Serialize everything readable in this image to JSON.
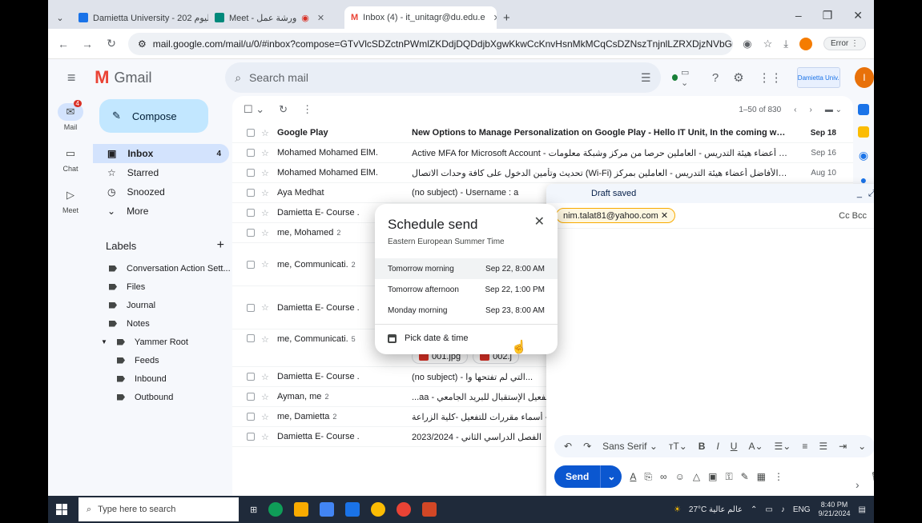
{
  "tabs": [
    {
      "title": "Damietta University - اليوم 202..",
      "active": false
    },
    {
      "title": "Meet - ورشة عمل",
      "active": false
    },
    {
      "title": "Inbox (4) - it_unitagr@du.edu.e",
      "active": true
    }
  ],
  "address_bar": {
    "url": "mail.google.com/mail/u/0/#inbox?compose=GTvVlcSDZctnPWmlZKDdjDQDdjbXgwKkwCcKnvHsnMkMCqCsDZNszTnjnlLZRXDjzNVbGmZLNRvSD",
    "error_label": "Error"
  },
  "gmail": {
    "brand": "Gmail",
    "search_placeholder": "Search mail",
    "org_logo_text": "Damietta Univ."
  },
  "rail": [
    {
      "label": "Mail",
      "badge": "4",
      "icon": "mail-icon"
    },
    {
      "label": "Chat",
      "icon": "chat-icon"
    },
    {
      "label": "Meet",
      "icon": "video-icon"
    }
  ],
  "sidebar": {
    "compose": "Compose",
    "items": [
      {
        "label": "Inbox",
        "count": "4",
        "icon": "inbox-icon"
      },
      {
        "label": "Starred",
        "count": "",
        "icon": "star-icon"
      },
      {
        "label": "Snoozed",
        "count": "",
        "icon": "clock-icon"
      },
      {
        "label": "More",
        "count": "",
        "icon": "chevron-down-icon"
      }
    ],
    "labels_heading": "Labels",
    "labels": [
      "Conversation Action Sett...",
      "Files",
      "Journal",
      "Notes",
      "Yammer Root"
    ],
    "sub_labels": [
      "Feeds",
      "Inbound",
      "Outbound"
    ]
  },
  "list": {
    "range": "1–50 of 830",
    "rows": [
      {
        "sender": "Google Play",
        "num": "",
        "subject": "New Options to Manage Personalization on Google Play - Hello IT Unit, In the coming weeks, Goog...",
        "date": "Sep 18",
        "unread": true
      },
      {
        "sender": "Mohamed Mohamed ElM.",
        "num": "",
        "subject": "Active MFA for Microsoft Account - السلام عليكم السادة الأفاضل أعضاء هيئة التدريس - العاملين حرصا من مركز وشبكة معلومات ...",
        "date": "Sep 16",
        "unread": false
      },
      {
        "sender": "Mohamed Mohamed ElM.",
        "num": "",
        "subject": "تحديث وتأمين الدخول على كافة وحدات الاتصال (Wi-Fi) بالجامعة - السلام عليكم السادة الأفاضل أعضاء هيئة التدريس - العاملين بمركز ...",
        "date": "Aug 10",
        "unread": false
      },
      {
        "sender": "Aya Medhat",
        "num": "",
        "subject": "(no subject) - Username : a",
        "date": "",
        "unread": false
      },
      {
        "sender": "Damietta E- Course .",
        "num": "",
        "subject": "",
        "date": "",
        "unread": false
      },
      {
        "sender": "me, Mohamed",
        "num": "2",
        "subject": "",
        "date": "",
        "unread": false
      },
      {
        "sender": "me, Communicati.",
        "num": "2",
        "subject": "",
        "date": "",
        "unread": false
      },
      {
        "sender": "Damietta E- Course .",
        "num": "",
        "subject": "",
        "date": "",
        "unread": false
      },
      {
        "sender": "me, Communicati.",
        "num": "5",
        "subject": "req - تم عمل الفرم",
        "date": "",
        "unread": false,
        "attachments": [
          "001.jpg",
          "002.j"
        ]
      },
      {
        "sender": "Damietta E- Course .",
        "num": "",
        "subject": "(no subject) - التي لم تفتحها وا...",
        "date": "",
        "unread": false
      },
      {
        "sender": "Ayman, me",
        "num": "2",
        "subject": "...aa - تفعيل الإستقبال للبريد الجامعي",
        "date": "",
        "unread": false
      },
      {
        "sender": "me, Damietta",
        "num": "2",
        "subject": "أسماء مقررات للتفعيل -كلية الزراعة -",
        "date": "",
        "unread": false
      },
      {
        "sender": "Damietta E- Course .",
        "num": "",
        "subject": "2023/2024 - الفصل الدراسي الثاني",
        "date": "",
        "unread": false
      }
    ]
  },
  "draft": {
    "title": "Draft saved",
    "recipient": "nim.talat81@yahoo.com",
    "cc_bcc": "Cc Bcc",
    "font": "Sans Serif",
    "send": "Send"
  },
  "schedule": {
    "title": "Schedule send",
    "timezone": "Eastern European Summer Time",
    "options": [
      {
        "label": "Tomorrow morning",
        "time": "Sep 22, 8:00 AM",
        "highlighted": true
      },
      {
        "label": "Tomorrow afternoon",
        "time": "Sep 22, 1:00 PM",
        "highlighted": false
      },
      {
        "label": "Monday morning",
        "time": "Sep 23, 8:00 AM",
        "highlighted": false
      }
    ],
    "pick": "Pick date & time"
  },
  "taskbar": {
    "search_placeholder": "Type here to search",
    "weather": "27°C عالم عالية",
    "lang": "ENG",
    "time": "8:40 PM",
    "date": "9/21/2024"
  },
  "colors": {
    "accent": "#0b57d0",
    "compose_bg": "#c2e7ff",
    "selected_nav": "#d3e3fd",
    "gmail_red": "#ea4335"
  }
}
